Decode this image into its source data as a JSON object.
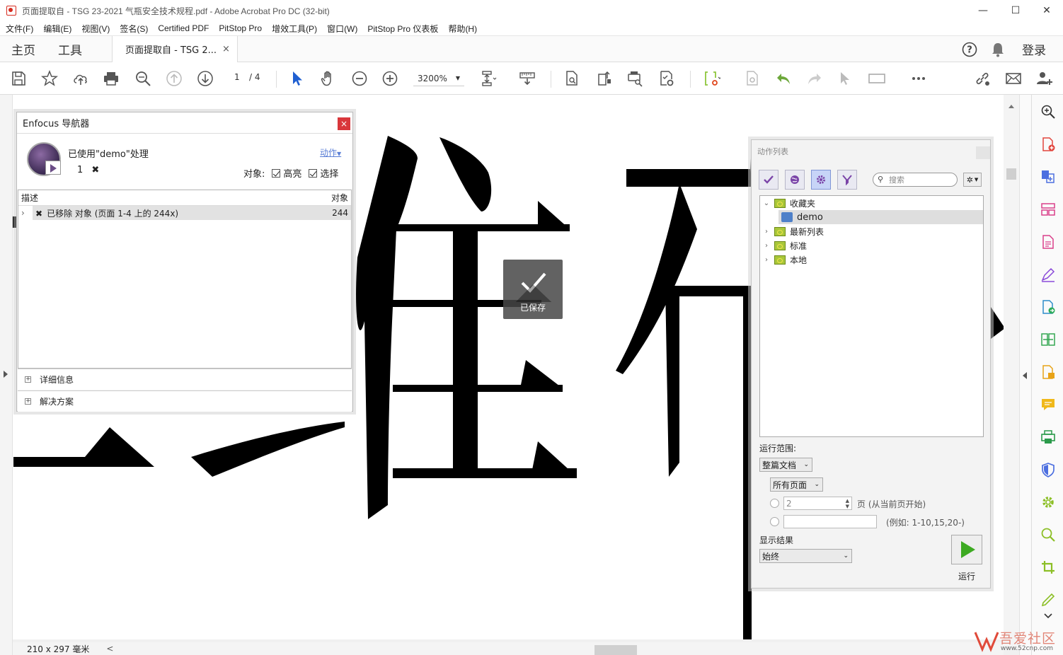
{
  "window": {
    "title": "页面提取自 - TSG 23-2021 气瓶安全技术规程.pdf - Adobe Acrobat Pro DC (32-bit)",
    "minimize": "—",
    "maximize": "☐",
    "close": "✕"
  },
  "menu": [
    "文件(F)",
    "编辑(E)",
    "视图(V)",
    "签名(S)",
    "Certified PDF",
    "PitStop Pro",
    "增效工具(P)",
    "窗口(W)",
    "PitStop Pro 仪表板",
    "帮助(H)"
  ],
  "tabs": {
    "home": "主页",
    "tools": "工具",
    "document": "页面提取自 - TSG 2...",
    "close": "×",
    "help": "?",
    "login": "登录"
  },
  "toolbar": {
    "page_current": "1",
    "page_total": "/ 4",
    "zoom": "3200%"
  },
  "status": {
    "page_size": "210 x 297 毫米",
    "collapse": "<"
  },
  "toast": {
    "label": "已保存"
  },
  "navigator": {
    "title": "Enfocus 导航器",
    "close": "×",
    "processed": "已使用\"demo\"处理",
    "count": "1",
    "action_link": "动作",
    "object_label": "对象:",
    "highlight_label": "高亮",
    "highlight_checked": true,
    "select_label": "选择",
    "select_checked": true,
    "columns": {
      "desc": "描述",
      "objects": "对象"
    },
    "rows": [
      {
        "desc": "已移除 对象 (页面 1-4 上的 244x)",
        "objects": "244"
      }
    ],
    "details": "详细信息",
    "solutions": "解决方案"
  },
  "actions": {
    "title": "动作列表",
    "search_placeholder": "搜索",
    "tree": [
      {
        "label": "收藏夹",
        "expanded": true
      },
      {
        "label": "demo",
        "selected": true
      },
      {
        "label": "最新列表"
      },
      {
        "label": "标准"
      },
      {
        "label": "本地"
      }
    ],
    "scope_label": "运行范围:",
    "scope_value": "整篇文档",
    "pages_value": "所有页面",
    "page_count_value": "2",
    "page_hint": "页 (从当前页开始)",
    "range_hint": "(例如: 1-10,15,20-)",
    "result_label": "显示结果",
    "result_value": "始终",
    "run_label": "运行"
  },
  "watermark": {
    "text": "吾爱社区",
    "url": "www.52cnp.com"
  }
}
